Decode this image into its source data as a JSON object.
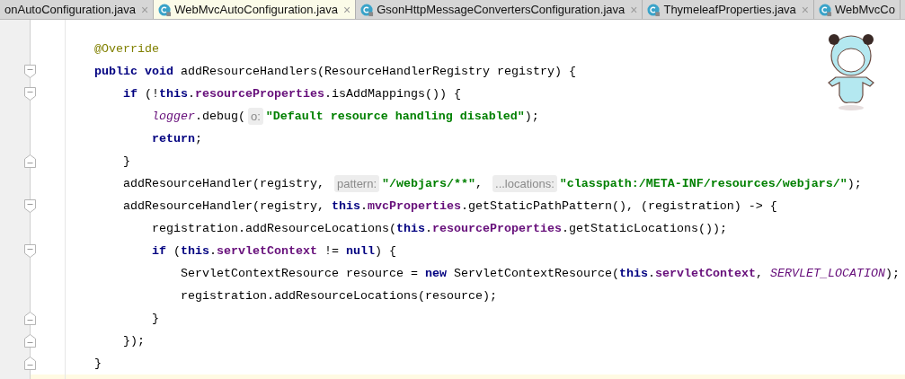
{
  "tabs": [
    {
      "label": "onAutoConfiguration.java",
      "icon": false,
      "closable": true,
      "selected": false
    },
    {
      "label": "WebMvcAutoConfiguration.java",
      "icon": true,
      "closable": true,
      "selected": true
    },
    {
      "label": "GsonHttpMessageConvertersConfiguration.java",
      "icon": true,
      "closable": true,
      "selected": false
    },
    {
      "label": "ThymeleafProperties.java",
      "icon": true,
      "closable": true,
      "selected": false
    },
    {
      "label": "WebMvcCo",
      "icon": true,
      "closable": false,
      "selected": false
    }
  ],
  "close_glyph": "×",
  "editor": {
    "lines": [
      {
        "tokens": [
          {
            "kind": "annotation",
            "text": "@Override"
          }
        ]
      },
      {
        "fold_marker": true,
        "tokens": [
          {
            "kind": "keyword",
            "text": "public void"
          },
          {
            "kind": "plain",
            "text": " addResourceHandlers(ResourceHandlerRegistry registry) {"
          }
        ],
        "children": [
          {
            "fold_marker": true,
            "tokens": [
              {
                "kind": "keyword",
                "text": "if"
              },
              {
                "kind": "plain",
                "text": " (!"
              },
              {
                "kind": "keyword",
                "text": "this"
              },
              {
                "kind": "plain",
                "text": "."
              },
              {
                "kind": "field",
                "text": "resourceProperties"
              },
              {
                "kind": "plain",
                "text": ".isAddMappings()) {"
              }
            ],
            "children": [
              {
                "tokens": [
                  {
                    "kind": "static",
                    "text": "logger"
                  },
                  {
                    "kind": "plain",
                    "text": ".debug("
                  },
                  {
                    "kind": "hint",
                    "text": "o:"
                  },
                  {
                    "kind": "string",
                    "text": "\"Default resource handling disabled\""
                  },
                  {
                    "kind": "plain",
                    "text": ");"
                  }
                ]
              },
              {
                "tokens": [
                  {
                    "kind": "keyword",
                    "text": "return"
                  },
                  {
                    "kind": "plain",
                    "text": ";"
                  }
                ]
              }
            ]
          },
          {
            "fold_marker": true,
            "tokens": [
              {
                "kind": "plain",
                "text": "}"
              }
            ]
          },
          {
            "tokens": [
              {
                "kind": "plain",
                "text": "addResourceHandler(registry, "
              },
              {
                "kind": "hint",
                "text": "pattern:"
              },
              {
                "kind": "string",
                "text": "\"/webjars/**\""
              },
              {
                "kind": "plain",
                "text": ", "
              },
              {
                "kind": "hint",
                "text": "...locations:"
              },
              {
                "kind": "string",
                "text": "\"classpath:/META-INF/resources/webjars/\""
              },
              {
                "kind": "plain",
                "text": ");"
              }
            ]
          },
          {
            "fold_marker": true,
            "tokens": [
              {
                "kind": "plain",
                "text": "addResourceHandler(registry, "
              },
              {
                "kind": "keyword",
                "text": "this"
              },
              {
                "kind": "plain",
                "text": "."
              },
              {
                "kind": "field",
                "text": "mvcProperties"
              },
              {
                "kind": "plain",
                "text": ".getStaticPathPattern(), (registration) -> {"
              }
            ],
            "children": [
              {
                "tokens": [
                  {
                    "kind": "plain",
                    "text": "registration.addResourceLocations("
                  },
                  {
                    "kind": "keyword",
                    "text": "this"
                  },
                  {
                    "kind": "plain",
                    "text": "."
                  },
                  {
                    "kind": "field",
                    "text": "resourceProperties"
                  },
                  {
                    "kind": "plain",
                    "text": ".getStaticLocations());"
                  }
                ]
              },
              {
                "fold_marker": true,
                "tokens": [
                  {
                    "kind": "keyword",
                    "text": "if"
                  },
                  {
                    "kind": "plain",
                    "text": " ("
                  },
                  {
                    "kind": "keyword",
                    "text": "this"
                  },
                  {
                    "kind": "plain",
                    "text": "."
                  },
                  {
                    "kind": "field",
                    "text": "servletContext"
                  },
                  {
                    "kind": "plain",
                    "text": " != "
                  },
                  {
                    "kind": "keyword",
                    "text": "null"
                  },
                  {
                    "kind": "plain",
                    "text": ") {"
                  }
                ],
                "children": [
                  {
                    "tokens": [
                      {
                        "kind": "plain",
                        "text": "ServletContextResource resource = "
                      },
                      {
                        "kind": "keyword",
                        "text": "new"
                      },
                      {
                        "kind": "plain",
                        "text": " ServletContextResource("
                      },
                      {
                        "kind": "keyword",
                        "text": "this"
                      },
                      {
                        "kind": "plain",
                        "text": "."
                      },
                      {
                        "kind": "field",
                        "text": "servletContext"
                      },
                      {
                        "kind": "plain",
                        "text": ", "
                      },
                      {
                        "kind": "static",
                        "text": "SERVLET_LOCATION"
                      },
                      {
                        "kind": "plain",
                        "text": ");"
                      }
                    ]
                  },
                  {
                    "tokens": [
                      {
                        "kind": "plain",
                        "text": "registration.addResourceLocations(resource);"
                      }
                    ]
                  }
                ]
              },
              {
                "fold_marker": true,
                "tokens": [
                  {
                    "kind": "plain",
                    "text": "}"
                  }
                ]
              }
            ]
          },
          {
            "fold_marker": true,
            "tokens": [
              {
                "kind": "plain",
                "text": "});"
              }
            ]
          }
        ]
      },
      {
        "fold_marker": true,
        "tokens": [
          {
            "kind": "plain",
            "text": "}"
          }
        ]
      },
      {
        "current": true
      }
    ]
  }
}
